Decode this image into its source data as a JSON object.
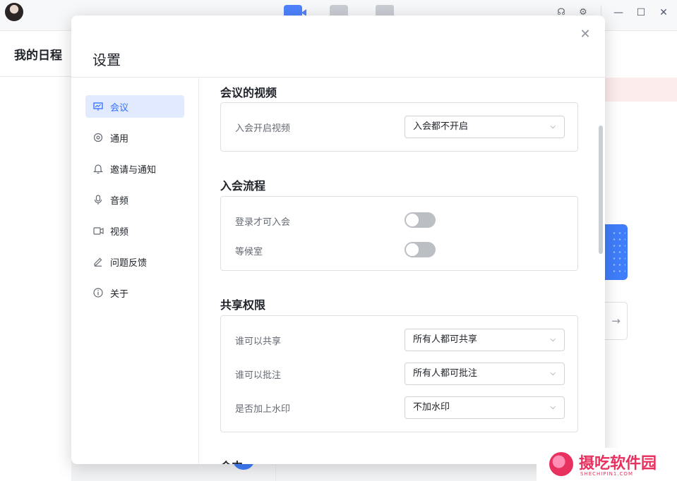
{
  "topbar": {
    "tabs": [
      {
        "icon": "video-meeting-icon",
        "active": true,
        "color": "#4e83fd"
      },
      {
        "icon": "apps-grid-icon",
        "active": false
      },
      {
        "icon": "document-icon",
        "active": false
      }
    ],
    "right_icons": [
      "headset-icon",
      "gear-icon"
    ],
    "window_controls": {
      "minimize": "—",
      "maximize": "☐",
      "close": "✕"
    }
  },
  "schedule": {
    "title": "我的日程"
  },
  "settings": {
    "title": "设置",
    "close_symbol": "✕",
    "nav": [
      {
        "label": "会议",
        "icon": "presentation-icon",
        "active": true
      },
      {
        "label": "通用",
        "icon": "gear-icon"
      },
      {
        "label": "邀请与通知",
        "icon": "bell-icon"
      },
      {
        "label": "音频",
        "icon": "microphone-icon"
      },
      {
        "label": "视频",
        "icon": "camera-icon"
      },
      {
        "label": "问题反馈",
        "icon": "pencil-icon"
      },
      {
        "label": "关于",
        "icon": "info-icon"
      }
    ],
    "sections": {
      "video": {
        "title": "会议的视频",
        "rows": [
          {
            "label": "入会开启视频",
            "value": "入会都不开启"
          }
        ]
      },
      "join": {
        "title": "入会流程",
        "rows": [
          {
            "label": "登录才可入会",
            "on": false
          },
          {
            "label": "等候室",
            "on": false
          }
        ]
      },
      "share": {
        "title": "共享权限",
        "rows": [
          {
            "label": "谁可以共享",
            "value": "所有人都可共享"
          },
          {
            "label": "谁可以批注",
            "value": "所有人都可批注"
          },
          {
            "label": "是否加上水印",
            "value": "不加水印"
          }
        ]
      },
      "next": {
        "title": "会中"
      }
    }
  },
  "watermark": {
    "text": "摄吃软件园",
    "sub": "SHECHIPIN1.COM"
  },
  "colors": {
    "accent": "#3370ff",
    "active_bg": "#e1eaff",
    "toggle_off": "#bbbfc4"
  }
}
